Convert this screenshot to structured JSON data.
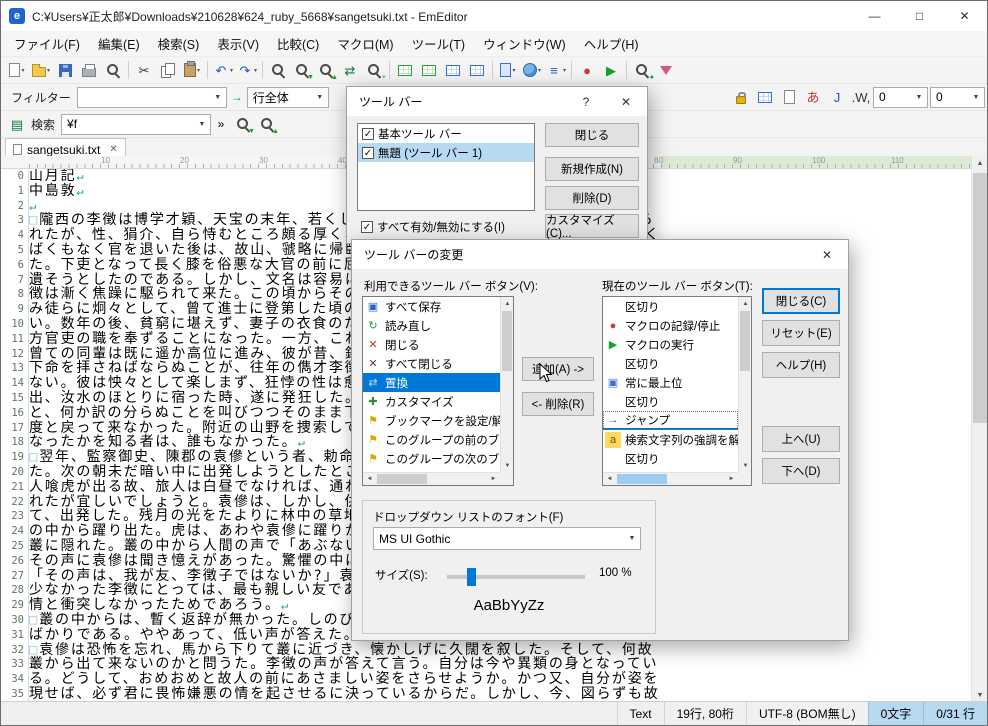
{
  "window": {
    "title": "C:¥Users¥正太郎¥Downloads¥210628¥624_ruby_5668¥sangetsuki.txt - EmEditor",
    "app_badge": "e",
    "controls": {
      "minimize": "—",
      "maximize": "□",
      "close": "✕"
    }
  },
  "menu_bar": {
    "items": [
      "ファイル(F)",
      "編集(E)",
      "検索(S)",
      "表示(V)",
      "比較(C)",
      "マクロ(M)",
      "ツール(T)",
      "ウィンドウ(W)",
      "ヘルプ(H)"
    ],
    "names": [
      "file",
      "edit",
      "search",
      "view",
      "compare",
      "macros",
      "tools",
      "window",
      "help"
    ]
  },
  "main_toolbar": {
    "items": [
      {
        "n": "new-file",
        "cls": "i-doc",
        "dd": true
      },
      {
        "n": "open-file",
        "cls": "i-folder",
        "dd": true
      },
      {
        "n": "save",
        "cls": "i-floppy"
      },
      {
        "n": "print",
        "cls": "i-print"
      },
      {
        "n": "print-preview",
        "cls": "i-mag"
      },
      {
        "sep": true
      },
      {
        "n": "cut",
        "g": "✂",
        "c": "#3a3a3a"
      },
      {
        "n": "copy",
        "cls": "i-copy"
      },
      {
        "n": "paste",
        "cls": "i-paste",
        "dd": true
      },
      {
        "sep": true
      },
      {
        "n": "undo",
        "g": "↶",
        "c": "#2459c4",
        "dd": true
      },
      {
        "n": "redo",
        "g": "↷",
        "c": "#2459c4",
        "dd": true
      },
      {
        "sep": true
      },
      {
        "n": "find",
        "cls": "i-mag"
      },
      {
        "n": "find-next",
        "cls": "i-mag",
        "ov": "▼"
      },
      {
        "n": "find-previous",
        "cls": "i-mag",
        "ov": "▲"
      },
      {
        "n": "replace",
        "g": "⇄",
        "c": "#0a7a3a"
      },
      {
        "n": "find-in-files",
        "cls": "i-mag",
        "ov": "+"
      },
      {
        "sep": true
      },
      {
        "n": "csv-standard",
        "cls": "i-grid-g"
      },
      {
        "n": "csv-comma",
        "cls": "i-grid-g"
      },
      {
        "n": "csv-tab",
        "cls": "i-grid-b"
      },
      {
        "n": "csv-semicolon",
        "cls": "i-grid-b"
      },
      {
        "sep": true
      },
      {
        "n": "html-toolbar",
        "cls": "i-doc-b",
        "dd": true
      },
      {
        "n": "web-preview",
        "cls": "i-globe",
        "dd": true
      },
      {
        "n": "plugins",
        "g": "≡",
        "c": "#2459c4",
        "dd": true
      },
      {
        "sep": true
      },
      {
        "n": "record-macro",
        "g": "●",
        "c": "#d03a2a"
      },
      {
        "n": "run-macro",
        "g": "▶",
        "c": "#18a12e"
      },
      {
        "sep": true
      },
      {
        "n": "search-highlight",
        "cls": "i-mag",
        "ov": "●"
      },
      {
        "n": "advanced-filter",
        "cls": "i-funnel-p"
      }
    ]
  },
  "filter_toolbar": {
    "label": "フィルター",
    "filter_value": "",
    "apply_glyph": "→",
    "match_scope": "行全体",
    "right_icons": [
      {
        "n": "lock",
        "cls": "i-lock"
      },
      {
        "n": "cell-toolbar",
        "cls": "i-grid-b"
      },
      {
        "n": "character-count",
        "cls": "i-doc"
      },
      {
        "n": "cjk-input",
        "g": "あ",
        "c": "#c0392b"
      },
      {
        "n": "jump-marker",
        "g": "J",
        "c": "#2459c4"
      },
      {
        "n": "word-wrap",
        "g": ".W,",
        "c": "#333"
      }
    ],
    "spin_values": [
      "0",
      "0"
    ]
  },
  "search_toolbar": {
    "label": "検索",
    "value": "¥f",
    "overflow": "»",
    "buttons": [
      {
        "n": "find-next-toolbar",
        "cls": "i-mag",
        "ov": "▼"
      },
      {
        "n": "find-previous-toolbar",
        "cls": "i-mag",
        "ov": "▲"
      }
    ]
  },
  "tab_bar": {
    "tabs": [
      {
        "label": "sangetsuki.txt",
        "close_glyph": "✕",
        "active": true
      }
    ]
  },
  "ruler": {
    "marks": [
      "10",
      "20",
      "30",
      "40",
      "50",
      "60",
      "70",
      "80",
      "90",
      "100",
      "110"
    ]
  },
  "editor": {
    "space_mark": "□",
    "newline_mark": "↵",
    "lines": [
      {
        "n": "0",
        "t": "山月記",
        "cr": true
      },
      {
        "n": "1",
        "t": "中島敦",
        "cr": true
      },
      {
        "n": "2",
        "t": "",
        "cr": true
      },
      {
        "n": "3",
        "sp": true,
        "t": "隴西の李徴は博学才穎、天宝の末年、若くして名を虎榜に連ね、ついで江南尉に補せら"
      },
      {
        "n": "4",
        "t": "れたが、性、狷介、自ら恃むところ頗る厚く、賤吏に甘んずるを潔しとしなかった。いく"
      },
      {
        "n": "5",
        "t": "ばくもなく官を退いた後は、故山、虢略に帰臥し、人と交を絶って、ひたすら詩作に耽っ"
      },
      {
        "n": "6",
        "t": "た。下吏となって長く膝を俗悪な大官の前に屈するよりは、詩家としての名を死後百年に"
      },
      {
        "n": "7",
        "t": "遺そうとしたのである。しかし、文名は容易に揚らず、生活は日を逐うて苦しくなる。李"
      },
      {
        "n": "8",
        "t": "徴は漸く焦躁に駆られて来た。この頃からその容貌も峭刻となり、肉落ち骨秀で、眼光の"
      },
      {
        "n": "9",
        "t": "み徒らに炯々として、曾て進士に登第した頃の豊頬の美少年の俤は、何処に求めようもな"
      },
      {
        "n": "10",
        "t": "い。数年の後、貧窮に堪えず、妻子の衣食のために遂に節を屈して、再び東へ赴き、一地"
      },
      {
        "n": "11",
        "t": "方官吏の職を奉ずることになった。一方、これは、己の詩業に半ば絶望したためでもある。"
      },
      {
        "n": "12",
        "t": "曾ての同輩は既に遥か高位に進み、彼が昔、鈍物として歯牙にもかけなかったその連中の"
      },
      {
        "n": "13",
        "t": "下命を拝さねばならぬことが、往年の儁才李徴の自尊心を如何に傷けたかは、想像に難く"
      },
      {
        "n": "14",
        "t": "ない。彼は怏々として楽しまず、狂悖の性は愈々抑え難くなった。一年の後、公用で旅に"
      },
      {
        "n": "15",
        "t": "出、汝水のほとりに宿った時、遂に発狂した。或夜半、急に顔色を変えて寝床から起上る"
      },
      {
        "n": "16",
        "t": "と、何か訳の分らぬことを叫びつつそのまま下にとび下りて、闇の中へ駈出した。彼は二"
      },
      {
        "n": "17",
        "t": "度と戻って来なかった。附近の山野を捜索しても、何の手掛りもない。その後李徴がどう"
      },
      {
        "n": "18",
        "t": "なったかを知る者は、誰もなかった。",
        "cr": true
      },
      {
        "n": "19",
        "sp": true,
        "t": "翌年、監察御史、陳郡の袁傪という者、勅命を奉じて嶺南に使し、途に商於の地に宿っ"
      },
      {
        "n": "20",
        "t": "た。次の朝未だ暗い中に出発しようとしたところ、駅吏が言うことに、これから先の道に"
      },
      {
        "n": "21",
        "t": "人喰虎が出る故、旅人は白昼でなければ、通れない。今はまだ朝が早いから、今少し待た"
      },
      {
        "n": "22",
        "t": "れたが宜しいでしょうと。袁傪は、しかし、供回りの多勢なのを恃み、駅吏の言葉を斥け"
      },
      {
        "n": "23",
        "t": "て、出発した。残月の光をたよりに林中の草地を通って行った時、果して一匹の猛虎が叢"
      },
      {
        "n": "24",
        "t": "の中から躍り出た。虎は、あわや袁傪に躍りかかるかと見えたが、忽ち身を翻して、元の"
      },
      {
        "n": "25",
        "t": "叢に隠れた。叢の中から人間の声で「あぶないところだった」と繰返し呟くのが聞えた。"
      },
      {
        "n": "26",
        "t": "その声に袁傪は聞き憶えがあった。驚懼の中にも、彼は咄嗟に思いあたって、叫んだ。"
      },
      {
        "n": "27",
        "t": "「その声は、我が友、李徴子ではないか?」袁傪は李徴と同年に進士の第に登り、友人の"
      },
      {
        "n": "28",
        "t": "少なかった李徴にとっては、最も親しい友であった。温和な袁傪の性格が、峻峭な李徴の"
      },
      {
        "n": "29",
        "t": "情と衝突しなかったためであろう。",
        "cr": true
      },
      {
        "n": "30",
        "sp": true,
        "t": "叢の中からは、暫く返辞が無かった。しのび泣きかと思われる微かな声が時々洩れる"
      },
      {
        "n": "31",
        "t": "ばかりである。ややあって、低い声が答えた。「如何にも自分は隴西の李徴である」と。",
        "cr": true
      },
      {
        "n": "32",
        "sp": true,
        "t": "袁傪は恐怖を忘れ、馬から下りて叢に近づき、懐かしげに久闊を叙した。そして、何故"
      },
      {
        "n": "33",
        "t": "叢から出て来ないのかと問うた。李徴の声が答えて言う。自分は今や異類の身となってい"
      },
      {
        "n": "34",
        "t": "る。どうして、おめおめと故人の前にあさましい姿をさらせようか。かつ又、自分が姿を"
      },
      {
        "n": "35",
        "t": "現せば、必ず君に畏怖嫌悪の情を起させるに決っているからだ。しかし、今、図らずも故"
      }
    ]
  },
  "status_bar": {
    "segments": [
      {
        "text": "Text"
      },
      {
        "text": "19行, 80桁"
      },
      {
        "text": "UTF-8 (BOM無し)"
      },
      {
        "text": "0文字",
        "highlight": true
      },
      {
        "text": "0/31 行",
        "highlight": true
      }
    ]
  },
  "toolbars_dialog": {
    "title": "ツール バー",
    "help": "?",
    "close_x": "✕",
    "list": [
      {
        "label": "基本ツール バー",
        "checked": true
      },
      {
        "label": "無題 (ツール バー 1)",
        "checked": true,
        "selected": true
      }
    ],
    "buttons": [
      {
        "label": "閉じる",
        "name": "close"
      },
      {
        "label": "新規作成(N)",
        "name": "new"
      },
      {
        "label": "削除(D)",
        "name": "delete"
      },
      {
        "label": "カスタマイズ(C)...",
        "name": "customize"
      }
    ],
    "enable_all": "すべて有効/無効にする(I)",
    "enable_all_checked": true
  },
  "customize_dialog": {
    "title": "ツール バーの変更",
    "close_x": "✕",
    "available_label": "利用できるツール バー ボタン(V):",
    "current_label": "現在のツール バー ボタン(T):",
    "add_label": "追加(A) ->",
    "remove_label": "<- 削除(R)",
    "available_items": [
      {
        "label": "すべて保存",
        "g": "▣",
        "c": "#2b5fc0"
      },
      {
        "label": "読み直し",
        "g": "↻",
        "c": "#18a12e"
      },
      {
        "label": "閉じる",
        "g": "✕",
        "c": "#c03a2a"
      },
      {
        "label": "すべて閉じる",
        "g": "✕",
        "c": "#8a2a2a"
      },
      {
        "label": "置換",
        "g": "⇄",
        "c": "#bfe0c5",
        "selected": true
      },
      {
        "label": "カスタマイズ",
        "g": "✚",
        "c": "#3a8a3a"
      },
      {
        "label": "ブックマークを設定/解除",
        "g": "⚑",
        "c": "#d9a800"
      },
      {
        "label": "このグループの前のブックマーク",
        "g": "⚑",
        "c": "#d9a800"
      },
      {
        "label": "このグループの次のブックマーク",
        "g": "⚑",
        "c": "#d9a800"
      }
    ],
    "current_items": [
      {
        "label": "区切り"
      },
      {
        "label": "マクロの記録/停止",
        "g": "●",
        "c": "#d03a2a"
      },
      {
        "label": "マクロの実行",
        "g": "▶",
        "c": "#18a12e"
      },
      {
        "label": "区切り"
      },
      {
        "label": "常に最上位",
        "g": "▣",
        "c": "#3a6fd0"
      },
      {
        "label": "区切り"
      },
      {
        "label": "ジャンプ",
        "g": "→",
        "c": "#2459c4",
        "insert": true
      },
      {
        "label": "検索文字列の強調を解除",
        "g": "a",
        "c": "#6a5a00",
        "bg": "#ffd95e"
      },
      {
        "label": "区切り"
      }
    ],
    "buttons": [
      {
        "label": "閉じる(C)",
        "name": "close",
        "default": true
      },
      {
        "label": "リセット(E)",
        "name": "reset"
      },
      {
        "label": "ヘルプ(H)",
        "name": "help"
      },
      {
        "label": "上へ(U)",
        "name": "move-up"
      },
      {
        "label": "下へ(D)",
        "name": "move-down"
      }
    ],
    "font_group": {
      "label": "ドロップダウン リストのフォント(F)",
      "font_name": "MS UI Gothic",
      "size_label": "サイズ(S):",
      "size_value": "100 %",
      "preview": "AaBbYyZz"
    }
  },
  "colors": {
    "accent": "#0078d7",
    "selection_blue": "#0078d7",
    "status_highlight": "#b7d9f0",
    "line_number": "#5a7a5a",
    "newline_mark_color": "#1aa0a0",
    "space_mark_color": "#9ec7e0"
  }
}
